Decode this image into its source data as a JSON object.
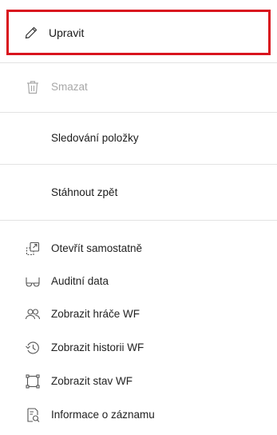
{
  "menu": {
    "edit": {
      "label": "Upravit",
      "icon": "pencil-icon"
    },
    "delete": {
      "label": "Smazat",
      "icon": "trash-icon",
      "disabled": true
    },
    "track": {
      "label": "Sledování položky"
    },
    "withdraw": {
      "label": "Stáhnout zpět"
    },
    "items": [
      {
        "label": "Otevřít samostatně",
        "icon": "open-external-icon"
      },
      {
        "label": "Auditní data",
        "icon": "glasses-icon"
      },
      {
        "label": "Zobrazit hráče WF",
        "icon": "users-icon"
      },
      {
        "label": "Zobrazit historii WF",
        "icon": "history-icon"
      },
      {
        "label": "Zobrazit stav WF",
        "icon": "frame-icon"
      },
      {
        "label": "Informace o záznamu",
        "icon": "record-info-icon"
      }
    ]
  },
  "colors": {
    "highlight_border": "#d9141e",
    "disabled_text": "#a8a8a8"
  }
}
